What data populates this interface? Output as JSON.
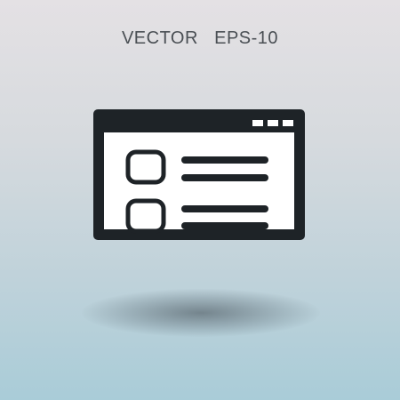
{
  "caption": "VECTOR   EPS-10",
  "colors": {
    "icon": "#1e2327",
    "caption": "#4a4f54",
    "background_top": "#e4e1e4",
    "background_bottom": "#a9ccd8"
  },
  "icon": {
    "name": "browser-window-list-icon",
    "title_bar_dots": 3,
    "list_rows": 2
  }
}
